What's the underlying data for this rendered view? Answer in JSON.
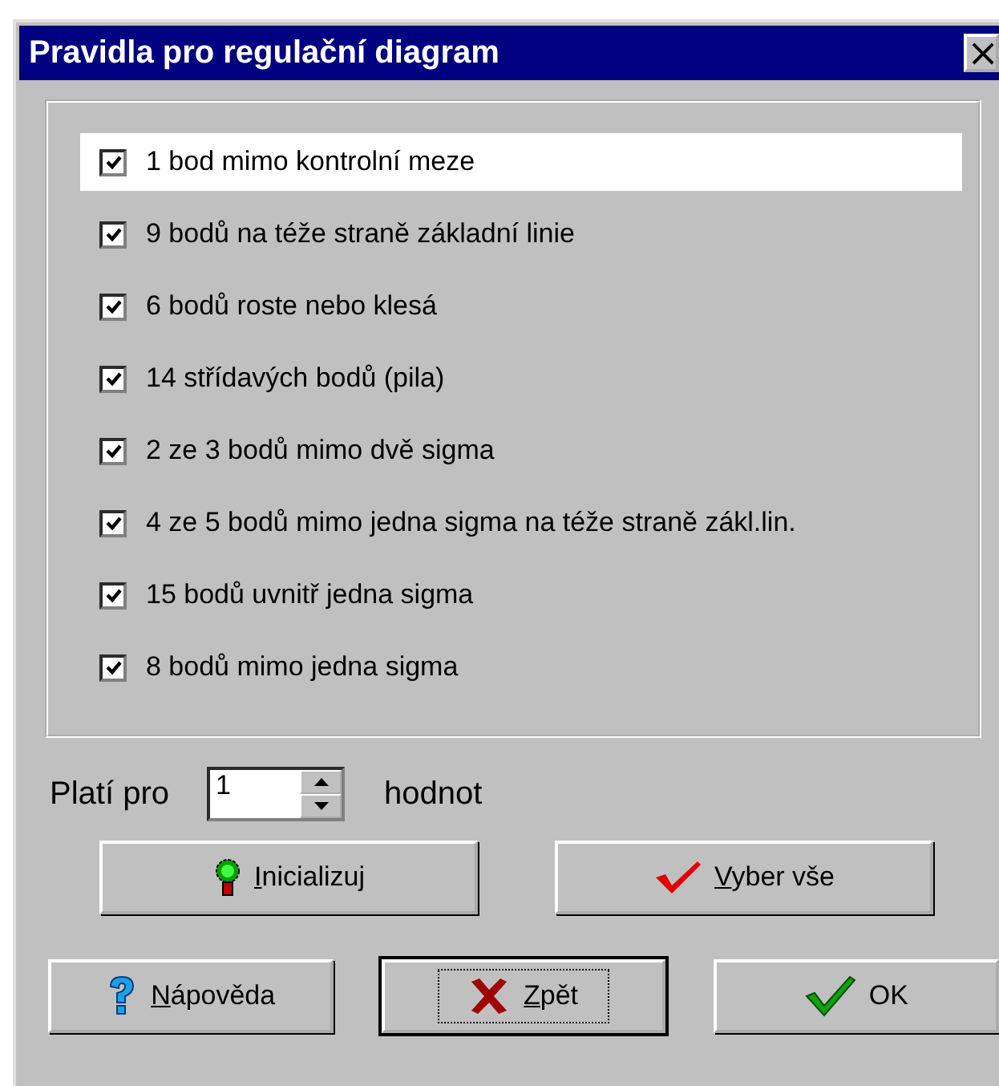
{
  "window": {
    "title": "Pravidla pro regulační diagram",
    "close_glyph": "×"
  },
  "rules": [
    {
      "label": "1 bod mimo kontrolní meze",
      "checked": true,
      "selected": true
    },
    {
      "label": "9 bodů na téže straně základní linie",
      "checked": true,
      "selected": false
    },
    {
      "label": "6 bodů roste nebo klesá",
      "checked": true,
      "selected": false
    },
    {
      "label": "14 střídavých bodů (pila)",
      "checked": true,
      "selected": false
    },
    {
      "label": "2 ze 3 bodů mimo dvě sigma",
      "checked": true,
      "selected": false
    },
    {
      "label": "4 ze 5 bodů mimo jedna sigma na téže straně zákl.lin.",
      "checked": true,
      "selected": false
    },
    {
      "label": "15 bodů uvnitř jedna sigma",
      "checked": true,
      "selected": false
    },
    {
      "label": "8 bodů mimo jedna sigma",
      "checked": true,
      "selected": false
    }
  ],
  "applies": {
    "prefix": "Platí pro",
    "value": "1",
    "suffix": "hodnot"
  },
  "action_buttons": [
    {
      "label": "Inicializuj",
      "kind": "lamp",
      "underline_first": true,
      "default": false
    },
    {
      "label": "Vyber vše",
      "kind": "redcheck",
      "underline_first": true,
      "default": false
    }
  ],
  "dialog_buttons": [
    {
      "label": "Nápověda",
      "kind": "help",
      "underline_first": true,
      "default": false
    },
    {
      "label": "Zpět",
      "kind": "cross",
      "underline_first": true,
      "default": true
    },
    {
      "label": "OK",
      "kind": "greencheck",
      "underline_first": false,
      "default": false
    }
  ]
}
